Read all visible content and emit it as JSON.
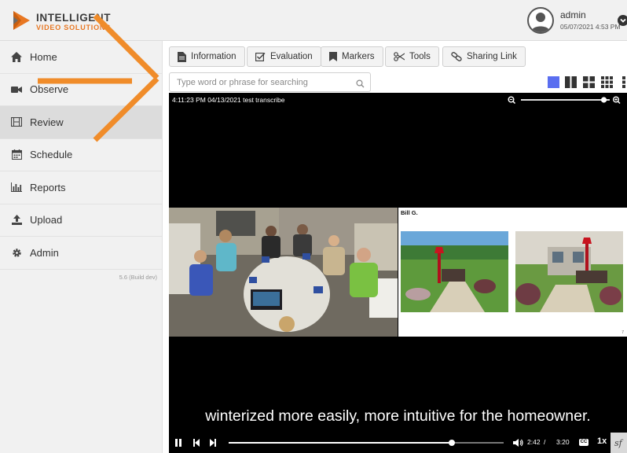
{
  "logo": {
    "line1": "INTELLIGENT",
    "line2": "VIDEO SOLUTIONS"
  },
  "user": {
    "name": "admin",
    "datetime": "05/07/2021 4:53 PM"
  },
  "sidebar": {
    "items": [
      {
        "label": "Home",
        "icon": "home-icon"
      },
      {
        "label": "Observe",
        "icon": "video-camera-icon"
      },
      {
        "label": "Review",
        "icon": "film-icon"
      },
      {
        "label": "Schedule",
        "icon": "calendar-icon"
      },
      {
        "label": "Reports",
        "icon": "bar-chart-icon"
      },
      {
        "label": "Upload",
        "icon": "upload-icon"
      },
      {
        "label": "Admin",
        "icon": "gear-icon"
      }
    ],
    "active": "Review",
    "build": "5.6 (Build dev)"
  },
  "toolbar": {
    "information": "Information",
    "evaluation": "Evaluation",
    "markers": "Markers",
    "tools": "Tools",
    "sharing_link": "Sharing Link"
  },
  "search": {
    "placeholder": "Type word or phrase for searching"
  },
  "player": {
    "title": "4:11:23 PM 04/13/2021 test transcribe",
    "slide_title": "Bill G.",
    "slide_page": "7",
    "caption": "winterized more easily, more intuitive for the homeowner.",
    "current_time": "2:42",
    "separator": "/",
    "duration": "3:20",
    "progress": 0.81,
    "zoom_level": 0.95,
    "cc_label": "CC",
    "speed": "1x"
  },
  "colors": {
    "accent_orange": "#f08c2a",
    "layout_active": "#5a6ef0",
    "logo_orange": "#e87722"
  }
}
